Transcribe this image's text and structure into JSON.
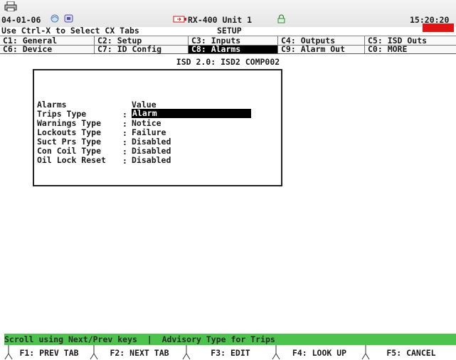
{
  "header": {
    "date": "04-01-06",
    "unit": "RX-400 Unit 1",
    "time": "15:20:20",
    "hint": "Use Ctrl-X to Select CX Tabs",
    "mode": "SETUP"
  },
  "tabs_row1": [
    {
      "label": "C1: General"
    },
    {
      "label": "C2: Setup"
    },
    {
      "label": "C3: Inputs"
    },
    {
      "label": "C4: Outputs"
    },
    {
      "label": "C5: ISD Outs"
    }
  ],
  "tabs_row2": [
    {
      "label": "C6: Device"
    },
    {
      "label": "C7: ID Config"
    },
    {
      "label": "C8: Alarms",
      "selected": true
    },
    {
      "label": "C9: Alarm Out"
    },
    {
      "label": "C0: MORE"
    }
  ],
  "screen_title": "ISD 2.0: ISD2 COMP002",
  "table": {
    "col1_header": "Alarms",
    "col2_header": "Value",
    "rows": [
      {
        "label": "Trips Type",
        "value": "Alarm"
      },
      {
        "label": "Warnings Type",
        "value": "Notice"
      },
      {
        "label": "Lockouts Type",
        "value": "Failure"
      },
      {
        "label": "Suct Prs Type",
        "value": "Disabled"
      },
      {
        "label": "Con Coil Type",
        "value": "Disabled"
      },
      {
        "label": "Oil Lock Reset",
        "value": "Disabled"
      }
    ]
  },
  "status": {
    "left": "Scroll using Next/Prev keys",
    "right": "Advisory Type for Trips"
  },
  "fkeys": [
    {
      "label": "F1: PREV TAB"
    },
    {
      "label": "F2: NEXT TAB"
    },
    {
      "label": "F3: EDIT"
    },
    {
      "label": "F4: LOOK UP"
    },
    {
      "label": "F5: CANCEL"
    }
  ],
  "colors": {
    "status_bar": "#4cc34c",
    "alarm_indicator": "#e01414",
    "selection": "#000000"
  },
  "icons": [
    "printer-icon",
    "network-icon",
    "status-icon",
    "battery-icon",
    "lock-icon"
  ]
}
